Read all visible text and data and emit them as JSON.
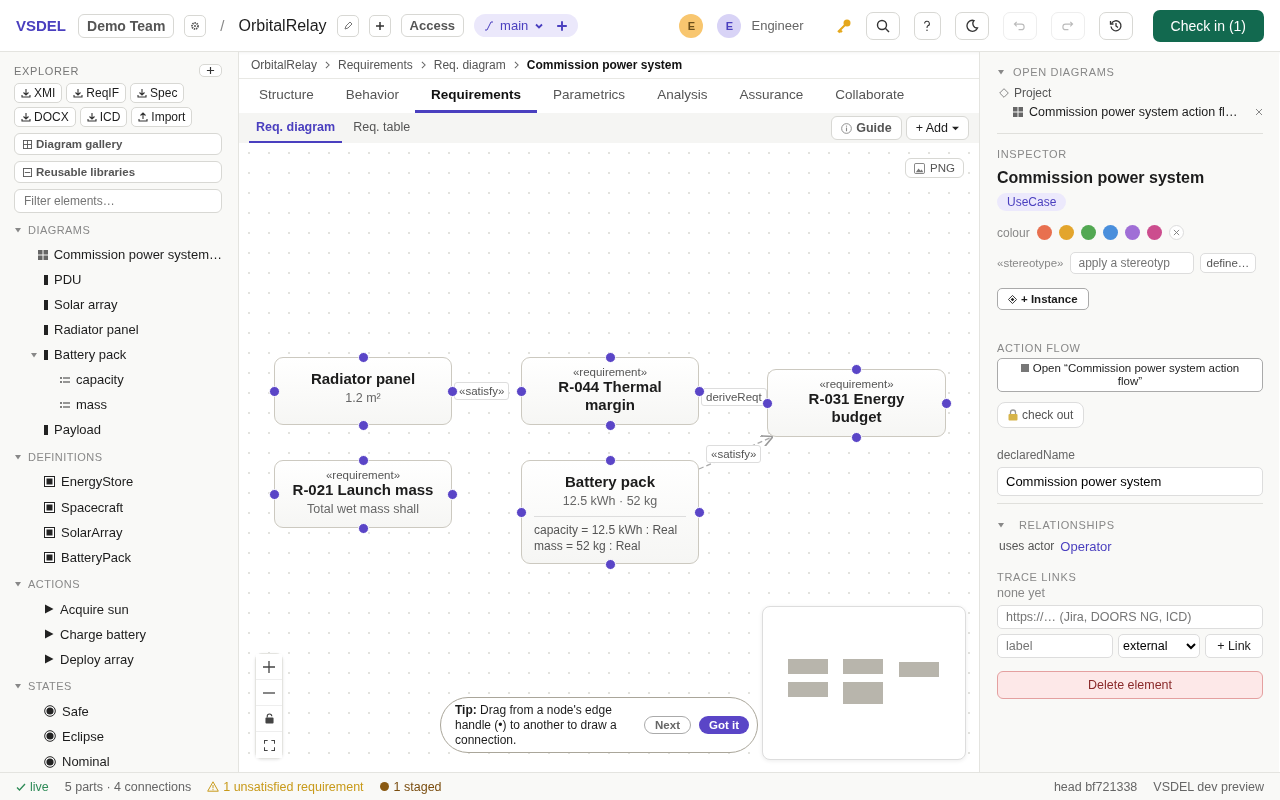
{
  "topbar": {
    "logo": "VSDEL",
    "team": "Demo Team",
    "separator": "/",
    "project": "OrbitalRelay",
    "access": "Access",
    "branch": "main",
    "avatars": [
      {
        "initial": "E",
        "color": "#f8c66f"
      },
      {
        "initial": "E",
        "color": "#d8d3f6"
      }
    ],
    "user": "Engineer",
    "undo_disabled": true,
    "redo_disabled": true,
    "checkin": "Check in (1)"
  },
  "explorer": {
    "title": "EXPLORER",
    "exports": [
      {
        "label": "XMI",
        "kind": "download"
      },
      {
        "label": "ReqIF",
        "kind": "download"
      },
      {
        "label": "Spec",
        "kind": "download"
      },
      {
        "label": "DOCX",
        "kind": "download"
      },
      {
        "label": "ICD",
        "kind": "download"
      },
      {
        "label": "Import",
        "kind": "upload"
      }
    ],
    "gallery": "Diagram gallery",
    "libraries": "Reusable libraries",
    "filter_placeholder": "Filter elements…",
    "sections": [
      {
        "title": "DIAGRAMS",
        "expanded": true,
        "items": [
          {
            "label": "Commission power system…",
            "kind": "diagram"
          },
          {
            "label": "PDU",
            "kind": "part"
          },
          {
            "label": "Solar array",
            "kind": "part"
          },
          {
            "label": "Radiator panel",
            "kind": "part"
          },
          {
            "label": "Battery pack",
            "kind": "part",
            "expanded": true,
            "children": [
              {
                "label": "capacity",
                "kind": "attribute"
              },
              {
                "label": "mass",
                "kind": "attribute"
              }
            ]
          },
          {
            "label": "Payload",
            "kind": "part"
          }
        ]
      },
      {
        "title": "DEFINITIONS",
        "expanded": true,
        "items": [
          {
            "label": "EnergyStore",
            "kind": "definition"
          },
          {
            "label": "Spacecraft",
            "kind": "definition"
          },
          {
            "label": "SolarArray",
            "kind": "definition"
          },
          {
            "label": "BatteryPack",
            "kind": "definition"
          }
        ]
      },
      {
        "title": "ACTIONS",
        "expanded": true,
        "items": [
          {
            "label": "Acquire sun",
            "kind": "action"
          },
          {
            "label": "Charge battery",
            "kind": "action"
          },
          {
            "label": "Deploy array",
            "kind": "action"
          }
        ]
      },
      {
        "title": "STATES",
        "expanded": true,
        "items": [
          {
            "label": "Safe",
            "kind": "state"
          },
          {
            "label": "Eclipse",
            "kind": "state"
          },
          {
            "label": "Nominal",
            "kind": "state"
          }
        ]
      }
    ]
  },
  "breadcrumb": [
    "OrbitalRelay",
    "Requirements",
    "Req. diagram",
    "Commission power system"
  ],
  "tabs": [
    {
      "label": "Structure",
      "selected": false
    },
    {
      "label": "Behavior",
      "selected": false
    },
    {
      "label": "Requirements",
      "selected": true
    },
    {
      "label": "Parametrics",
      "selected": false
    },
    {
      "label": "Analysis",
      "selected": false
    },
    {
      "label": "Assurance",
      "selected": false
    },
    {
      "label": "Collaborate",
      "selected": false
    }
  ],
  "subtabs": [
    {
      "label": "Req. diagram",
      "selected": true
    },
    {
      "label": "Req. table",
      "selected": false
    }
  ],
  "guide": "Guide",
  "add": "+ Add",
  "canvas": {
    "export": "PNG",
    "nodes": [
      {
        "kind": "block",
        "title": "Radiator panel",
        "subtitle": "1.2 m²"
      },
      {
        "kind": "requirement",
        "stereotype": "«requirement»",
        "title": "R-044 Thermal margin"
      },
      {
        "kind": "requirement",
        "stereotype": "«requirement»",
        "title": "R-031 Energy budget"
      },
      {
        "kind": "requirement",
        "stereotype": "«requirement»",
        "title": "R-021 Launch mass",
        "text": "Total wet mass shall"
      },
      {
        "kind": "block",
        "title": "Battery pack",
        "subtitle": "12.5 kWh · 52 kg",
        "attributes": [
          "capacity = 12.5 kWh : Real",
          "mass = 52 kg : Real"
        ]
      }
    ],
    "edges": [
      {
        "label": "«satisfy»"
      },
      {
        "label": "deriveReqt"
      },
      {
        "label": "«satisfy»"
      }
    ],
    "tip": "**Tip:** Drag from a node's edge handle (•) to another to draw a connection.",
    "tip_next": "Next",
    "tip_done": "Got it"
  },
  "open_diagrams": {
    "title": "OPEN DIAGRAMS",
    "expanded": true,
    "project": "Project",
    "items": [
      {
        "label": "Commission power system action fl…"
      }
    ]
  },
  "inspector": {
    "title": "INSPECTOR",
    "name": "Commission power system",
    "type": "UseCase",
    "colour_label": "colour",
    "swatches": [
      {
        "color": "#e8704f"
      },
      {
        "color": "#e3a52c"
      },
      {
        "color": "#52a852"
      },
      {
        "color": "#4a8fdc"
      },
      {
        "color": "#a06fd6"
      },
      {
        "color": "#cc4d8e"
      }
    ],
    "stereotype_label": "«stereotype»",
    "stereotype_placeholder": "apply a stereotyp",
    "define": "define…",
    "instance": "+ Instance",
    "action_flow_title": "ACTION FLOW",
    "action_flow_button": "Open “Commission power system action flow”",
    "checkout": "check out",
    "declared_label": "declaredName",
    "declared_value": "Commission power system"
  },
  "relationships": {
    "title": "RELATIONSHIPS",
    "expanded": true,
    "items": [
      {
        "label": "uses actor",
        "target": "Operator"
      }
    ]
  },
  "trace": {
    "title": "TRACE LINKS",
    "empty": "none yet",
    "url_placeholder": "https://… (Jira, DOORS NG, ICD)",
    "label_placeholder": "label",
    "type": "external",
    "link": "+ Link"
  },
  "delete": "Delete element",
  "status": {
    "live": "live",
    "counts": "5 parts · 4 connections",
    "warning": "1 unsatisfied requirement",
    "staged": "1 staged",
    "head": "head bf721338",
    "build": "VSDEL dev preview"
  }
}
